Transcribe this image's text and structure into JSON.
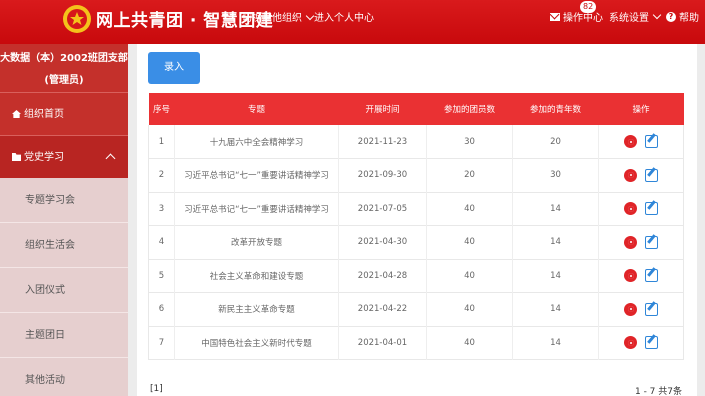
{
  "header": {
    "brand": "网上共青团 · 智慧团建",
    "switch_org": "切换其他组织",
    "personal_center": "进入个人中心",
    "ops_center": "操作中心",
    "ops_badge": "82",
    "settings": "系统设置",
    "help": "帮助"
  },
  "sidebar": {
    "org_name": "大数据（本）2002班团支部",
    "role": "(管理员)",
    "home": "组织首页",
    "party_study": "党史学习",
    "sub_items": [
      "专题学习会",
      "组织生活会",
      "入团仪式",
      "主题团日",
      "其他活动"
    ]
  },
  "main": {
    "add_button": "录入",
    "columns": [
      "序号",
      "专题",
      "开展时间",
      "参加的团员数",
      "参加的青年数",
      "操作"
    ],
    "rows": [
      {
        "no": "1",
        "topic": "十九届六中全会精神学习",
        "date": "2021-11-23",
        "members": "30",
        "youth": "20"
      },
      {
        "no": "2",
        "topic": "习近平总书记“七一”重要讲话精神学习",
        "date": "2021-09-30",
        "members": "20",
        "youth": "30"
      },
      {
        "no": "3",
        "topic": "习近平总书记“七一”重要讲话精神学习",
        "date": "2021-07-05",
        "members": "40",
        "youth": "14"
      },
      {
        "no": "4",
        "topic": "改革开放专题",
        "date": "2021-04-30",
        "members": "40",
        "youth": "14"
      },
      {
        "no": "5",
        "topic": "社会主义革命和建设专题",
        "date": "2021-04-28",
        "members": "40",
        "youth": "14"
      },
      {
        "no": "6",
        "topic": "新民主主义革命专题",
        "date": "2021-04-22",
        "members": "40",
        "youth": "14"
      },
      {
        "no": "7",
        "topic": "中国特色社会主义新时代专题",
        "date": "2021-04-01",
        "members": "40",
        "youth": "14"
      }
    ],
    "pager_current": "[1]",
    "pager_summary": "1 - 7  共7条"
  },
  "colors": {
    "header_red": "#c8090c",
    "sidebar_red": "#c4302b",
    "table_head_red": "#ea3133",
    "button_blue": "#3a8ee6"
  }
}
